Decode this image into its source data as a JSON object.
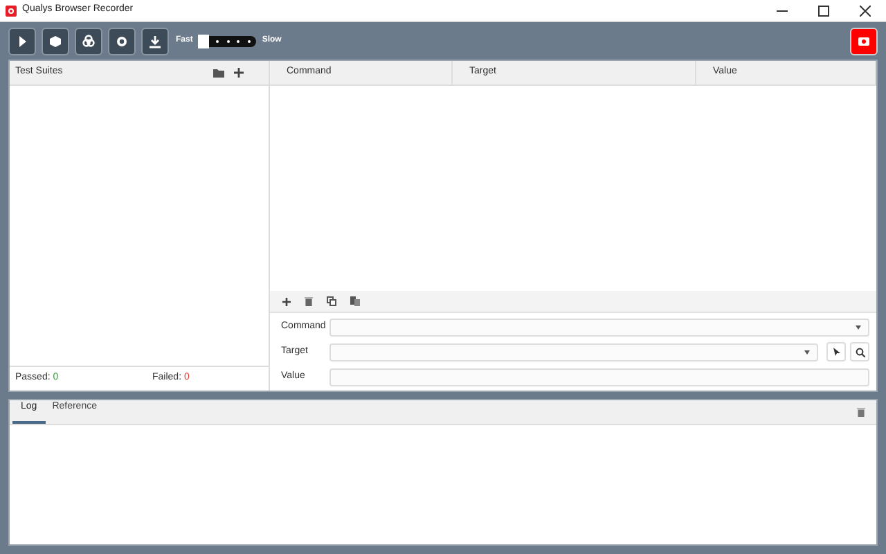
{
  "window": {
    "title": "Qualys Browser Recorder"
  },
  "toolbar": {
    "speed": {
      "fast_label": "Fast",
      "slow_label": "Slow",
      "level": 0
    }
  },
  "test_suites": {
    "title": "Test Suites",
    "passed_label": "Passed:",
    "passed": "0",
    "failed_label": "Failed:",
    "failed": "0"
  },
  "table": {
    "columns": [
      "Command",
      "Target",
      "Value"
    ]
  },
  "editor": {
    "fields": [
      {
        "label": "Command",
        "kind": "dropdown"
      },
      {
        "label": "Target",
        "kind": "dropdown-tools"
      },
      {
        "label": "Value",
        "kind": "text"
      }
    ]
  },
  "bottom": {
    "tabs": [
      {
        "label": "Log",
        "selected": true
      },
      {
        "label": "Reference",
        "selected": false
      }
    ]
  }
}
